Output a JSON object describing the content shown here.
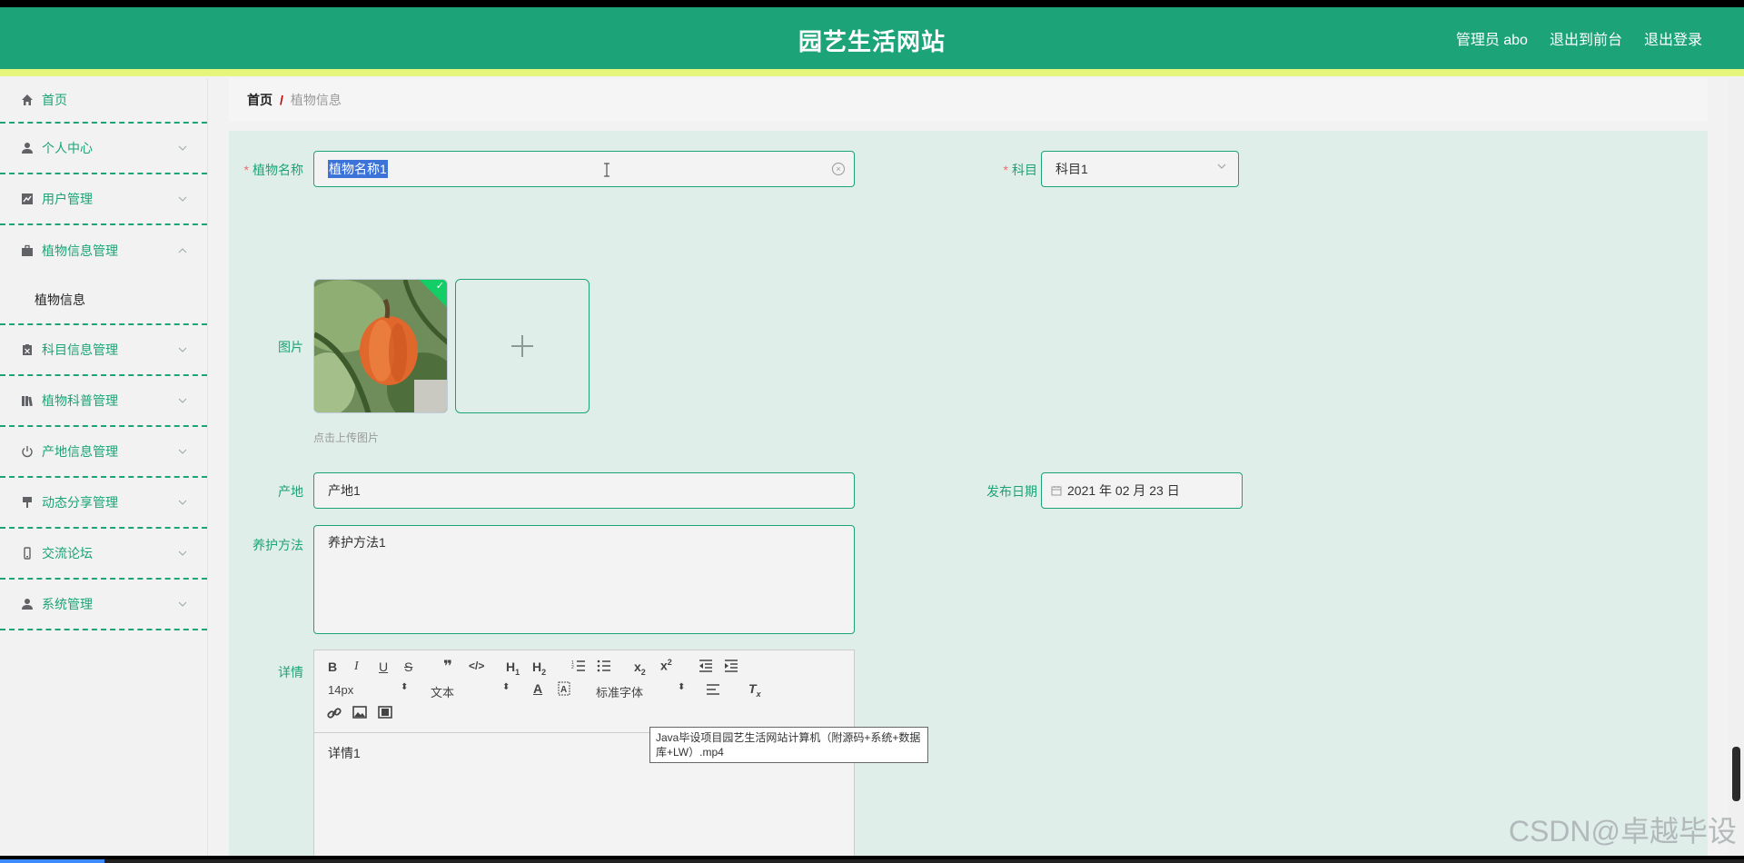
{
  "header": {
    "title": "园艺生活网站",
    "admin_label": "管理员 abo",
    "front_link": "退出到前台",
    "logout_link": "退出登录",
    "brand_color": "#1ca377",
    "stripe_color": "#e6f57b"
  },
  "sidebar": {
    "items": [
      {
        "label": "首页",
        "icon": "home-icon"
      },
      {
        "label": "个人中心",
        "icon": "user-icon"
      },
      {
        "label": "用户管理",
        "icon": "chart-icon"
      },
      {
        "label": "植物信息管理",
        "icon": "briefcase-icon",
        "expanded": true,
        "children": [
          "植物信息"
        ]
      },
      {
        "label": "科目信息管理",
        "icon": "clipboard-icon"
      },
      {
        "label": "植物科普管理",
        "icon": "books-icon"
      },
      {
        "label": "产地信息管理",
        "icon": "power-icon"
      },
      {
        "label": "动态分享管理",
        "icon": "pin-icon"
      },
      {
        "label": "交流论坛",
        "icon": "phone-icon"
      },
      {
        "label": "系统管理",
        "icon": "user-icon"
      }
    ]
  },
  "breadcrumb": {
    "home": "首页",
    "separator": "/",
    "current": "植物信息"
  },
  "form": {
    "name": {
      "label": "植物名称",
      "value": "植物名称1"
    },
    "subject": {
      "label": "科目",
      "value": "科目1"
    },
    "image": {
      "label": "图片",
      "hint": "点击上传图片"
    },
    "origin": {
      "label": "产地",
      "value": "产地1"
    },
    "publish_date": {
      "label": "发布日期",
      "value": "2021 年 02 月 23 日"
    },
    "care": {
      "label": "养护方法",
      "value": "养护方法1"
    },
    "detail": {
      "label": "详情",
      "value": "详情1"
    }
  },
  "editor": {
    "font_size": "14px",
    "text_style": "文本",
    "font_family": "标准字体"
  },
  "tooltip": "Java毕设项目园艺生活网站计算机（附源码+系统+数据库+LW）.mp4",
  "watermark": "CSDN@卓越毕设",
  "video_progress": 0.06
}
